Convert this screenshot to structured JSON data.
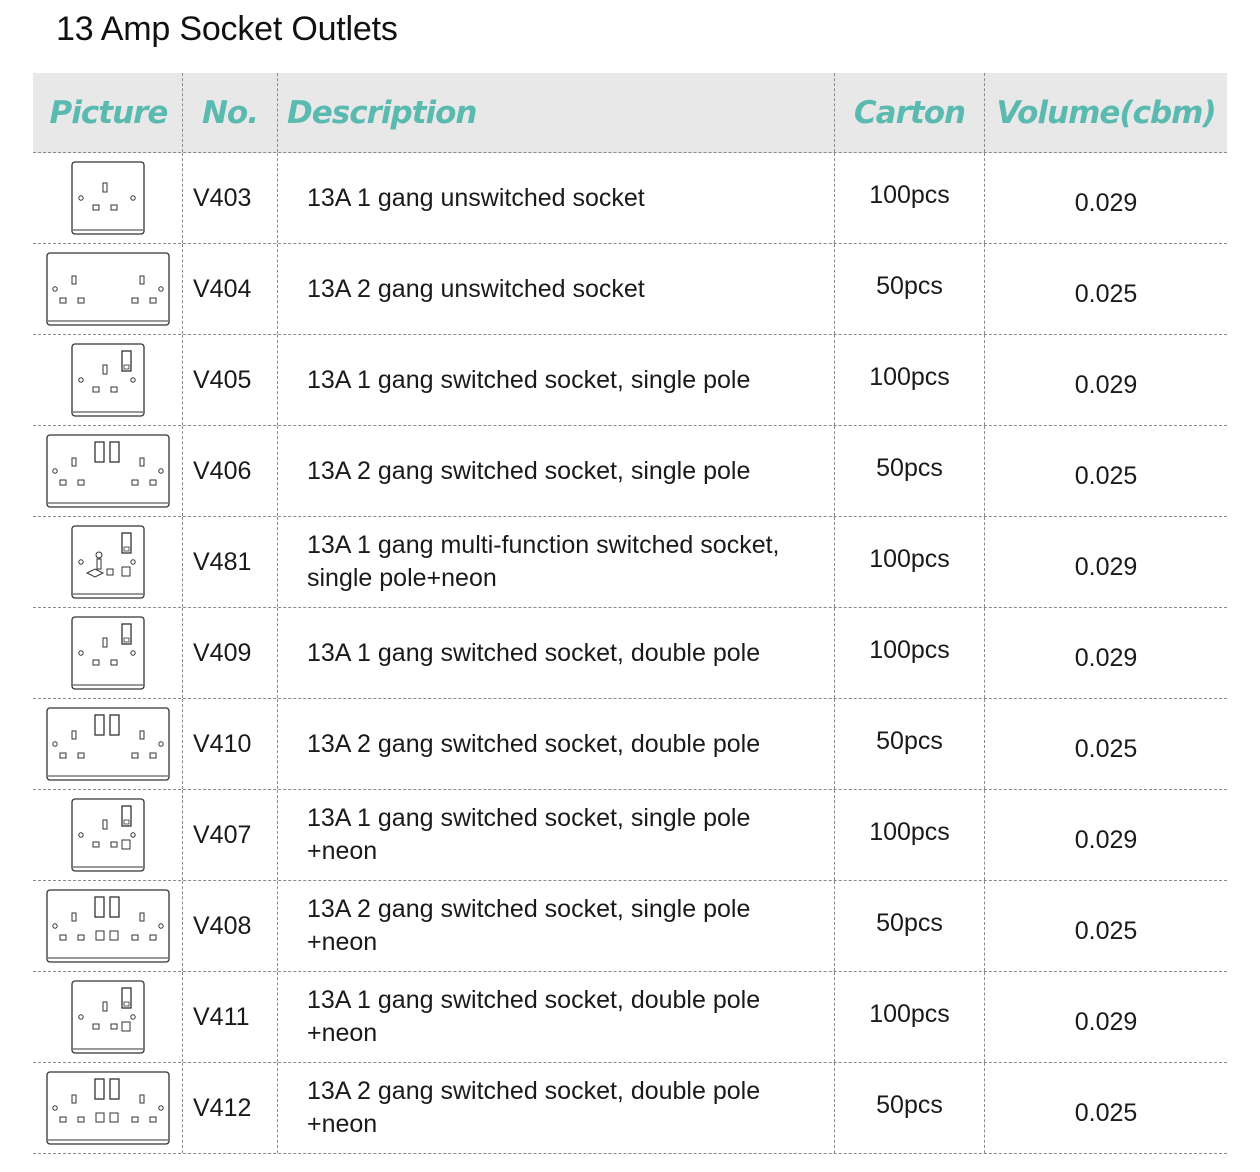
{
  "title": "13 Amp Socket Outlets",
  "headers": {
    "picture": "Picture",
    "no": "No.",
    "description": "Description",
    "carton": "Carton",
    "volume": "Volume(cbm)"
  },
  "colors": {
    "header_text": "#5bbab0",
    "header_bg": "#e8e8e8",
    "divider": "#8a8a8a"
  },
  "rows": [
    {
      "no": "V403",
      "description": "13A 1 gang unswitched socket",
      "carton": "100pcs",
      "volume": "0.029",
      "icon": "socket-1-gang-unswitched-icon",
      "gang": 1,
      "switches": 0,
      "neon": false,
      "multi": false
    },
    {
      "no": "V404",
      "description": "13A 2 gang unswitched socket",
      "carton": "50pcs",
      "volume": "0.025",
      "icon": "socket-2-gang-unswitched-icon",
      "gang": 2,
      "switches": 0,
      "neon": false,
      "multi": false
    },
    {
      "no": "V405",
      "description": "13A 1 gang switched socket, single pole",
      "carton": "100pcs",
      "volume": "0.029",
      "icon": "socket-1-gang-switched-icon",
      "gang": 1,
      "switches": 1,
      "neon": false,
      "multi": false
    },
    {
      "no": "V406",
      "description": "13A 2 gang switched socket, single pole",
      "carton": "50pcs",
      "volume": "0.025",
      "icon": "socket-2-gang-switched-icon",
      "gang": 2,
      "switches": 2,
      "neon": false,
      "multi": false
    },
    {
      "no": "V481",
      "description": "13A 1 gang multi-function switched socket, single pole+neon",
      "carton": "100pcs",
      "volume": "0.029",
      "icon": "socket-1-gang-multi-function-icon",
      "gang": 1,
      "switches": 1,
      "neon": true,
      "multi": true
    },
    {
      "no": "V409",
      "description": "13A 1 gang switched socket, double pole",
      "carton": "100pcs",
      "volume": "0.029",
      "icon": "socket-1-gang-switched-icon",
      "gang": 1,
      "switches": 1,
      "neon": false,
      "multi": false
    },
    {
      "no": "V410",
      "description": "13A 2 gang switched socket, double pole",
      "carton": "50pcs",
      "volume": "0.025",
      "icon": "socket-2-gang-switched-icon",
      "gang": 2,
      "switches": 2,
      "neon": false,
      "multi": false
    },
    {
      "no": "V407",
      "description": "13A 1 gang switched socket, single pole +neon",
      "carton": "100pcs",
      "volume": "0.029",
      "icon": "socket-1-gang-switched-neon-icon",
      "gang": 1,
      "switches": 1,
      "neon": true,
      "multi": false
    },
    {
      "no": "V408",
      "description": "13A 2 gang switched socket, single pole +neon",
      "carton": "50pcs",
      "volume": "0.025",
      "icon": "socket-2-gang-switched-neon-icon",
      "gang": 2,
      "switches": 2,
      "neon": true,
      "multi": false
    },
    {
      "no": "V411",
      "description": "13A 1 gang switched socket, double pole +neon",
      "carton": "100pcs",
      "volume": "0.029",
      "icon": "socket-1-gang-switched-neon-icon",
      "gang": 1,
      "switches": 1,
      "neon": true,
      "multi": false
    },
    {
      "no": "V412",
      "description": "13A 2 gang switched socket, double pole +neon",
      "carton": "50pcs",
      "volume": "0.025",
      "icon": "socket-2-gang-switched-neon-icon",
      "gang": 2,
      "switches": 2,
      "neon": true,
      "multi": false
    }
  ]
}
